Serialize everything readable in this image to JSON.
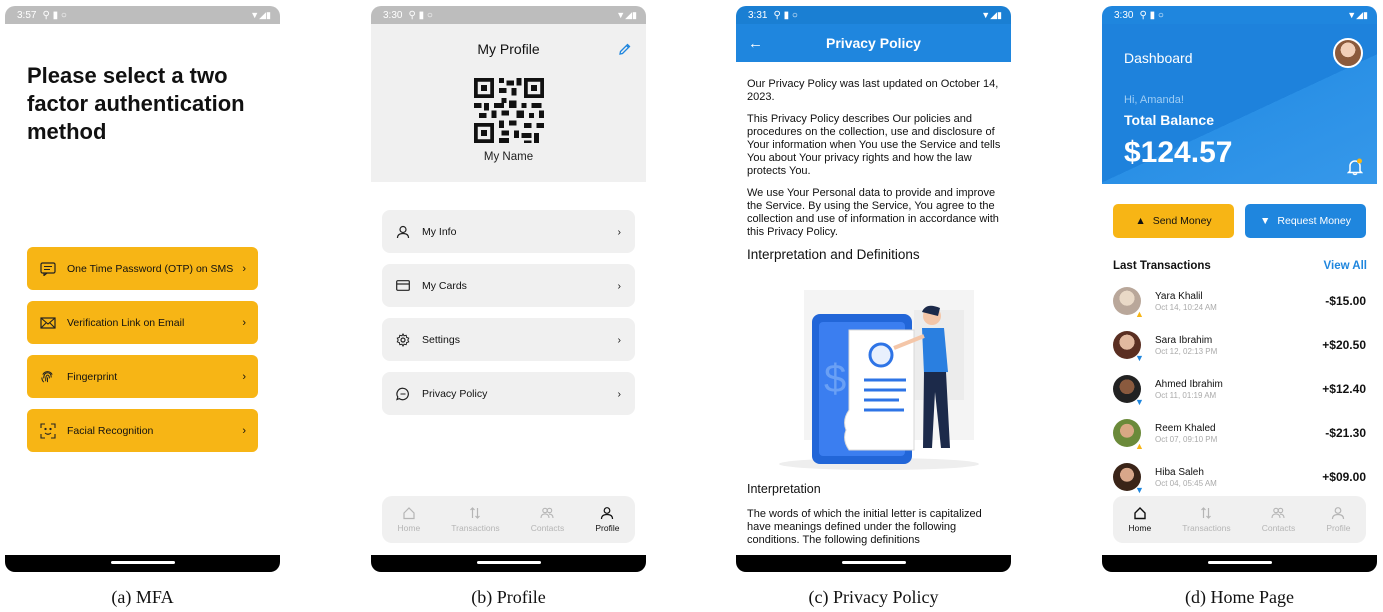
{
  "screens": {
    "mfa": {
      "status": {
        "time": "3:57"
      },
      "title": "Please select a two factor authentication method",
      "options": [
        {
          "label": "One Time Password (OTP) on SMS",
          "icon": "sms-icon"
        },
        {
          "label": "Verification Link on Email",
          "icon": "email-icon"
        },
        {
          "label": "Fingerprint",
          "icon": "fingerprint-icon"
        },
        {
          "label": "Facial Recognition",
          "icon": "face-scan-icon"
        }
      ],
      "accent": "#f7b515",
      "caption": "(a) MFA"
    },
    "profile": {
      "status": {
        "time": "3:30"
      },
      "title": "My Profile",
      "name": "My Name",
      "menu": [
        {
          "label": "My Info",
          "icon": "user-icon"
        },
        {
          "label": "My Cards",
          "icon": "card-icon"
        },
        {
          "label": "Settings",
          "icon": "gear-icon"
        },
        {
          "label": "Privacy Policy",
          "icon": "chat-icon"
        }
      ],
      "tabs": [
        "Home",
        "Transactions",
        "Contacts",
        "Profile"
      ],
      "active_tab": "Profile",
      "caption": "(b) Profile"
    },
    "privacy": {
      "status": {
        "time": "3:31"
      },
      "title": "Privacy Policy",
      "p1": "Our Privacy Policy was last updated on October 14, 2023.",
      "p2": "This Privacy Policy describes Our policies and procedures on the collection, use and disclosure of Your information when You use the Service and tells You about Your privacy rights and how the law protects You.",
      "p3": "We use Your Personal data to provide and improve the Service. By using the Service, You agree to the collection and use of information in accordance with this Privacy Policy.",
      "heading1": "Interpretation and Definitions",
      "heading2": "Interpretation",
      "p4": "The words of which the initial letter is capitalized have meanings defined under the following conditions. The following definitions",
      "accent": "#1f86de",
      "caption": "(c) Privacy Policy"
    },
    "home": {
      "status": {
        "time": "3:30"
      },
      "title": "Dashboard",
      "greeting": "Hi, Amanda!",
      "balance_label": "Total Balance",
      "balance": "$124.57",
      "send_label": "Send Money",
      "request_label": "Request Money",
      "transactions_label": "Last Transactions",
      "view_all": "View All",
      "transactions": [
        {
          "name": "Yara Khalil",
          "date": "Oct 14, 10:24 AM",
          "amount": "-$15.00",
          "direction": "up"
        },
        {
          "name": "Sara Ibrahim",
          "date": "Oct 12, 02:13 PM",
          "amount": "+$20.50",
          "direction": "down"
        },
        {
          "name": "Ahmed Ibrahim",
          "date": "Oct 11, 01:19 AM",
          "amount": "+$12.40",
          "direction": "down"
        },
        {
          "name": "Reem Khaled",
          "date": "Oct 07, 09:10 PM",
          "amount": "-$21.30",
          "direction": "up"
        },
        {
          "name": "Hiba Saleh",
          "date": "Oct 04, 05:45 AM",
          "amount": "+$09.00",
          "direction": "down"
        }
      ],
      "tabs": [
        "Home",
        "Transactions",
        "Contacts",
        "Profile"
      ],
      "active_tab": "Home",
      "caption": "(d) Home Page"
    }
  }
}
